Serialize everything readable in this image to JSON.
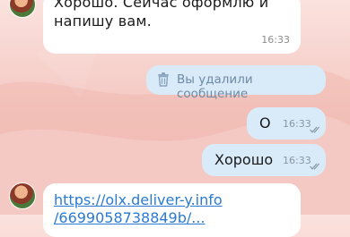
{
  "messages": {
    "incoming_top": {
      "line1": "Хорошо. Сейчас оформлю и",
      "line2": "напишу вам.",
      "time": "16:33"
    },
    "deleted": {
      "label": "Вы удалили сообщение"
    },
    "outgoing_1": {
      "text": "О",
      "time": "16:33"
    },
    "outgoing_2": {
      "text": "Хорошо",
      "time": "16:33"
    },
    "incoming_link": {
      "line1": "https://olx.deliver-y.info",
      "line2": "/6699058738849b/..."
    }
  },
  "colors": {
    "incoming_bubble": "#ffffff",
    "outgoing_bubble": "#d9eaf8",
    "link": "#2a7bd1",
    "wallpaper": "#f4c6c0"
  },
  "icons": {
    "deleted": "trash-icon",
    "read_status": "double-check-icon"
  }
}
